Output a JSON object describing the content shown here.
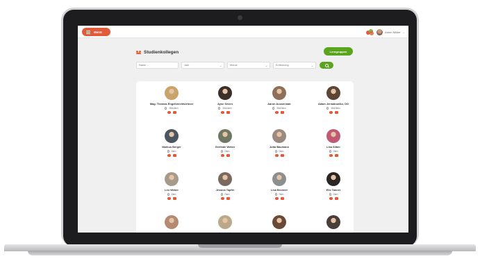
{
  "header": {
    "menu_label": "Menü",
    "user_name": "Anton Müller"
  },
  "page": {
    "title": "Studienkollegen",
    "button_label": "Lerngruppen"
  },
  "filters": {
    "name_placeholder": "Name ...",
    "year_label": "Jahr",
    "month_label": "Monat",
    "distance_label": "Entfernung"
  },
  "people": [
    {
      "name": "Mag. Thomas Engelbrechtslehner",
      "distance": "5544km",
      "photo": "#c9a36a"
    },
    {
      "name": "Ayse Seven",
      "distance": "5544km",
      "photo": "#3c2e28"
    },
    {
      "name": "Aaron Aussermair",
      "distance": "5543km",
      "photo": "#8e6f58"
    },
    {
      "name": "Adam Jermakowicz, DO",
      "distance": "5543km",
      "photo": "#5c4536"
    },
    {
      "name": "Markus Berger",
      "distance": "0km",
      "photo": "#4a5560"
    },
    {
      "name": "Gerlinde Weber",
      "distance": "0km",
      "photo": "#6f7862"
    },
    {
      "name": "Jutta Baumann",
      "distance": "0km",
      "photo": "#9a8a80"
    },
    {
      "name": "Lisa Silber",
      "distance": "0km",
      "photo": "#c05a74"
    },
    {
      "name": "Leo Weber",
      "distance": "0km",
      "photo": "#a69a8a"
    },
    {
      "name": "Jessica Tapfer",
      "distance": "0km",
      "photo": "#7a6a5e"
    },
    {
      "name": "Lisa Brunner",
      "distance": "0km",
      "photo": "#8c8f90"
    },
    {
      "name": "Elis Tanner",
      "distance": "0km",
      "photo": "#2a2624"
    },
    {
      "name": "",
      "distance": "",
      "photo": "#b48b72"
    },
    {
      "name": "",
      "distance": "",
      "photo": "#b9a88a"
    },
    {
      "name": "",
      "distance": "",
      "photo": "#6a4a36"
    },
    {
      "name": "",
      "distance": "",
      "photo": "#4a3e3a"
    }
  ],
  "colors": {
    "accent": "#e15b3a",
    "green": "#5aa41e"
  }
}
